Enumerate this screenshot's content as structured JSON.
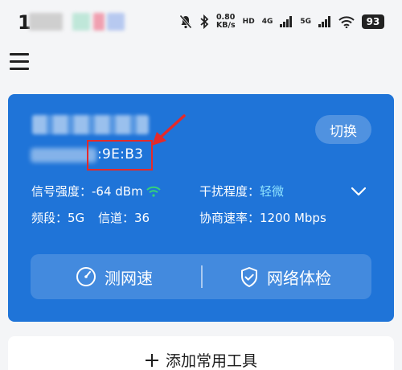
{
  "status_bar": {
    "time": "1",
    "speed_value": "0.80",
    "speed_unit": "KB/s",
    "hd_label": "HD",
    "net1": "4G",
    "net2": "5G",
    "battery": "93",
    "icons": [
      "mute-icon",
      "bluetooth-icon",
      "signal-icon",
      "signal-icon",
      "wifi-icon",
      "battery-icon"
    ]
  },
  "wifi_card": {
    "mac_suffix": ":9E:B3",
    "switch_label": "切换",
    "signal_label": "信号强度：",
    "signal_value": "-64 dBm",
    "interference_label": "干扰程度：",
    "interference_value": "轻微",
    "band_label": "频段：",
    "band_value": "5G",
    "channel_label": "信道：",
    "channel_value": "36",
    "rate_label": "协商速率：",
    "rate_value": "1200 Mbps",
    "tools": {
      "speed_test": "测网速",
      "network_check": "网络体检"
    }
  },
  "add_tool_label": "添加常用工具",
  "colors": {
    "card_blue": "#1f74d8",
    "annotation_red": "#e42a2a",
    "accent_cyan": "#8fe3ff",
    "wifi_green": "#34d27a"
  }
}
